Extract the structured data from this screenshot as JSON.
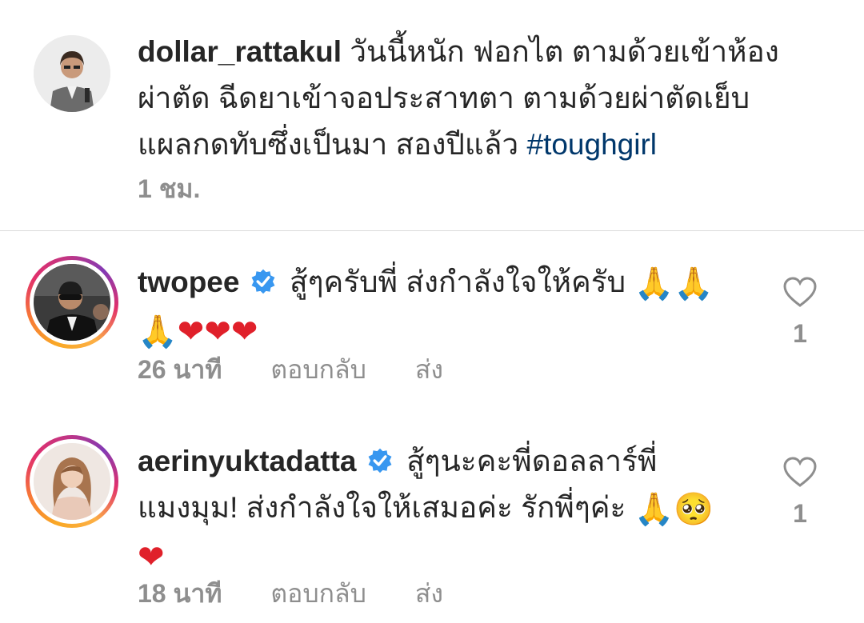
{
  "caption": {
    "username": "dollar_rattakul",
    "line1": "วันนี้หนัก ฟอกไต ตามด้วยเข้าห้อง",
    "line2": "ผ่าตัด ฉีดยาเข้าจอประสาทตา ตามด้วยผ่าตัดเย็บ",
    "line3": "แผลกดทับซึ่งเป็นมา สองปีแล้ว",
    "hashtag": "#toughgirl",
    "time": "1 ชม."
  },
  "comments": [
    {
      "username": "twopee",
      "verified": true,
      "line1": "สู้ๆครับพี่ ส่งกำลังใจให้ครับ",
      "emoji_line1": "🙏🙏",
      "emoji_line2": "🙏❤❤❤",
      "time": "26 นาที",
      "reply_label": "ตอบกลับ",
      "send_label": "ส่ง",
      "likes": "1"
    },
    {
      "username": "aerinyuktadatta",
      "verified": true,
      "line1": "สู้ๆนะคะพี่ดอลลาร์พี่",
      "line2": "แมงมุม! ส่งกำลังใจให้เสมอค่ะ รักพี่ๆค่ะ",
      "emoji_line2": "🙏🥺",
      "emoji_line3": "❤",
      "time": "18 นาที",
      "reply_label": "ตอบกลับ",
      "send_label": "ส่ง",
      "likes": "1"
    }
  ],
  "icons": {
    "verified": "verified-badge-icon",
    "like": "heart-outline-icon"
  },
  "colors": {
    "text": "#262626",
    "meta": "#8e8e8e",
    "hashtag": "#00376b",
    "verified": "#3897f0",
    "divider": "#dbdbdb"
  }
}
